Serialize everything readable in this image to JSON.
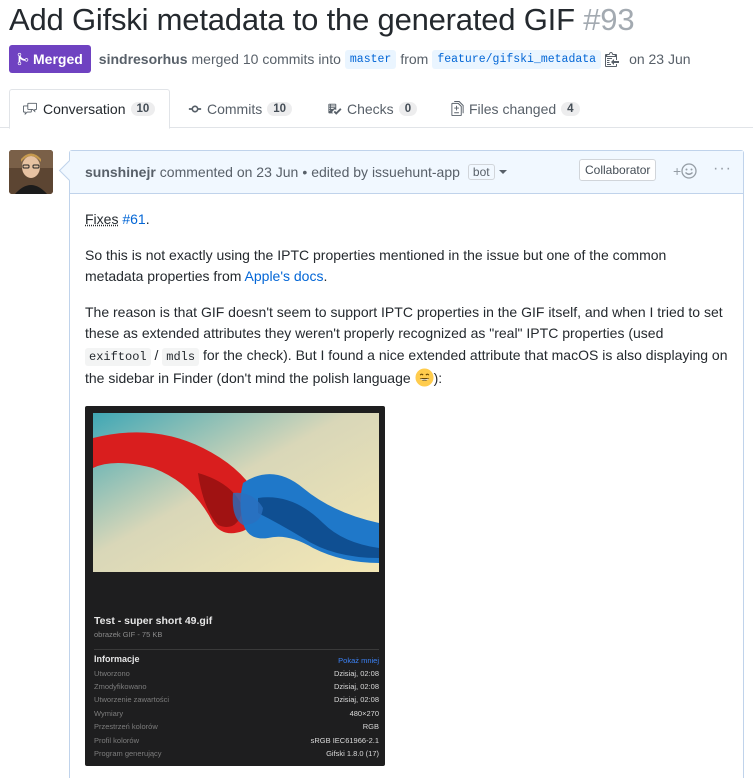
{
  "pr": {
    "title": "Add Gifski metadata to the generated GIF",
    "number": "#93",
    "state_label": "Merged",
    "author": "sindresorhus",
    "merged_text": "merged 10 commits into",
    "base_branch": "master",
    "from_text": "from",
    "head_branch": "feature/gifski_metadata",
    "date_text": "on 23 Jun"
  },
  "tabs": [
    {
      "label": "Conversation",
      "count": "10"
    },
    {
      "label": "Commits",
      "count": "10"
    },
    {
      "label": "Checks",
      "count": "0"
    },
    {
      "label": "Files changed",
      "count": "4"
    }
  ],
  "comment": {
    "author": "sunshinejr",
    "action": "commented on 23 Jun",
    "bullet": "•",
    "edited": "edited by issuehunt-app",
    "bot_label": "bot",
    "role_label": "Collaborator",
    "react_plus": "+",
    "more": "···",
    "fixes_prefix": "Fixes",
    "fixes_link": "#61",
    "fixes_suffix": ".",
    "p2_text": "So this is not exactly using the IPTC properties mentioned in the issue but one of the common metadata properties from",
    "p2_link": "Apple's docs",
    "p2_suffix": ".",
    "p3_a": "The reason is that GIF doesn't seem to support IPTC properties in the GIF itself, and when I tried to set these as extended attributes they weren't properly recognized as \"real\" IPTC properties (used",
    "p3_code1": "exiftool",
    "p3_slash": "/",
    "p3_code2": "mdls",
    "p3_b": "for the check). But I found a nice extended attribute that macOS is also displaying on the sidebar in Finder (don't mind the polish language",
    "p3_end": "):"
  },
  "screenshot": {
    "file_name": "Test - super short 49.gif",
    "file_type": "obrazek GIF - 75 KB",
    "info_heading": "Informacje",
    "show_less": "Pokaż mniej",
    "rows": [
      {
        "k": "Utworzono",
        "v": "Dzisiaj, 02:08"
      },
      {
        "k": "Zmodyfikowano",
        "v": "Dzisiaj, 02:08"
      },
      {
        "k": "Utworzenie zawartości",
        "v": "Dzisiaj, 02:08"
      },
      {
        "k": "Wymiary",
        "v": "480×270"
      },
      {
        "k": "Przestrzeń kolorów",
        "v": "RGB"
      },
      {
        "k": "Profil kolorów",
        "v": "sRGB IEC61966-2.1"
      },
      {
        "k": "Program generujący",
        "v": "Gifski 1.8.0 (17)"
      }
    ]
  },
  "colors": {
    "merged_purple": "#6f42c1",
    "link_blue": "#0366d6",
    "comment_header_bg": "#f1f8ff"
  }
}
